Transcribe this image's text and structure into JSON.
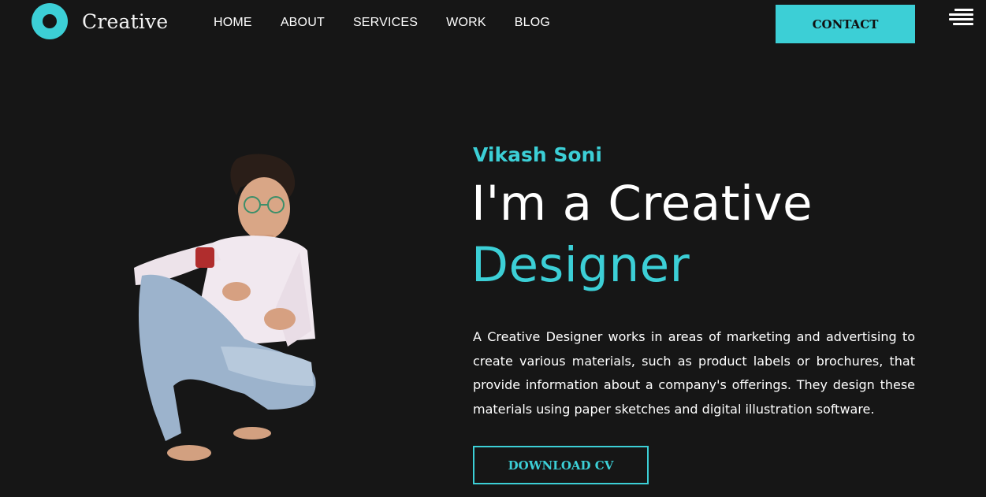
{
  "brand": {
    "name": "Creative",
    "accent_color": "#3ccfd6",
    "background_color": "#161616",
    "logo_icon": "ring-logo-icon"
  },
  "nav": {
    "items": [
      "HOME",
      "ABOUT",
      "SERVICES",
      "WORK",
      "BLOG"
    ]
  },
  "header": {
    "contact_label": "CONTACT",
    "menu_icon": "hamburger-menu-icon"
  },
  "hero": {
    "name": "Vikash Soni",
    "headline_line1": "I'm a Creative",
    "headline_line2": "Designer",
    "description": "A Creative Designer works in areas of marketing and advertising to create various materials, such as product labels or brochures, that provide information about a company's offerings. They design these materials using paper sketches and digital illustration software.",
    "download_label": "DOWNLOAD CV",
    "portrait": "person-crouching-portrait"
  }
}
